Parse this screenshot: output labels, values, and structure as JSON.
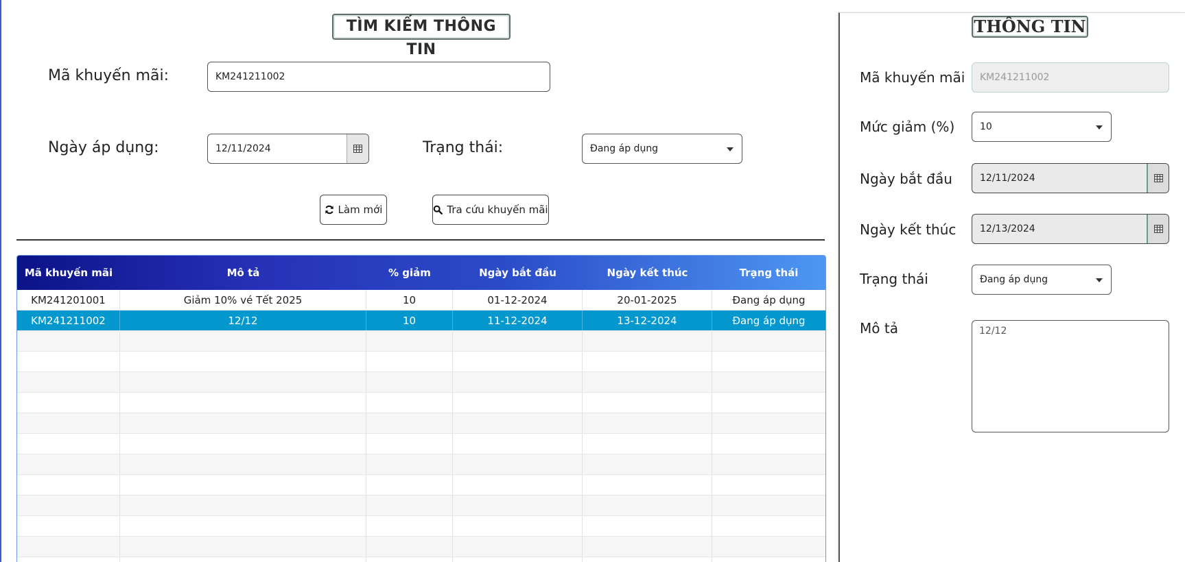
{
  "search": {
    "title": "TÌM KIẾM THÔNG TIN",
    "code_label": "Mã khuyến mãi:",
    "code_value": "KM241211002",
    "date_label": "Ngày áp dụng:",
    "date_value": "12/11/2024",
    "status_label": "Trạng thái:",
    "status_value": "Đang áp dụng",
    "refresh_label": "Làm mới",
    "search_label": "Tra cứu khuyến mãi"
  },
  "table": {
    "headers": [
      "Mã khuyến mãi",
      "Mô tả",
      "% giảm",
      "Ngày bắt đầu",
      "Ngày kết thúc",
      "Trạng thái"
    ],
    "rows": [
      [
        "KM241201001",
        "Giảm 10% vé Tết 2025",
        "10",
        "01-12-2024",
        "20-01-2025",
        "Đang áp dụng"
      ],
      [
        "KM241211002",
        "12/12",
        "10",
        "11-12-2024",
        "13-12-2024",
        "Đang áp dụng"
      ]
    ],
    "selected_row": 1
  },
  "info": {
    "title": "THÔNG TIN",
    "code_label": "Mã khuyến mãi",
    "code_value": "KM241211002",
    "discount_label": "Mức giảm (%)",
    "discount_value": "10",
    "start_label": "Ngày bắt đầu",
    "start_value": "12/11/2024",
    "end_label": "Ngày kết thúc",
    "end_value": "12/13/2024",
    "status_label": "Trạng thái",
    "status_value": "Đang áp dụng",
    "desc_label": "Mô tả",
    "desc_value": "12/12"
  },
  "icons": {
    "refresh": "refresh-icon",
    "search": "search-icon",
    "calendar": "calendar-icon",
    "dropdown": "chevron-down-icon"
  },
  "colors": {
    "header_start": "#0c1388",
    "header_end": "#4e97f2",
    "selected_row": "#0498ce"
  }
}
